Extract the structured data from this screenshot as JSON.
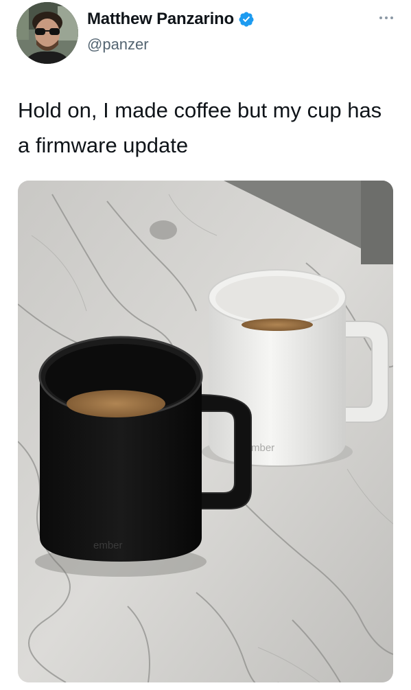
{
  "tweet": {
    "author": {
      "display_name": "Matthew Panzarino",
      "handle": "@panzer",
      "verified": true,
      "verified_color": "#1d9bf0"
    },
    "text": "Hold on, I made coffee but my cup has a firmware update",
    "more_icon": "more-horizontal-icon",
    "media": {
      "black_mug_logo": "ember",
      "white_mug_logo": "mber"
    }
  }
}
